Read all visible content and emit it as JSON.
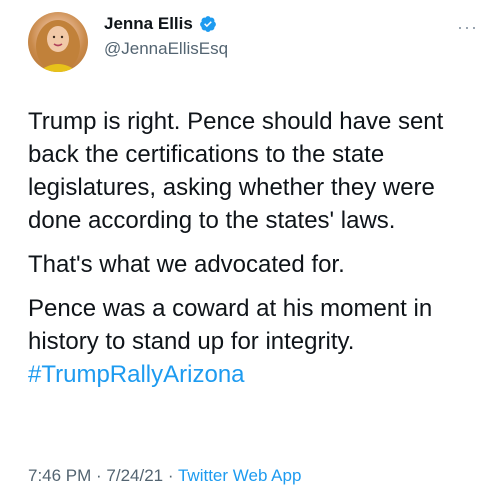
{
  "author": {
    "display_name": "Jenna Ellis",
    "handle": "@JennaEllisEsq",
    "verified": true
  },
  "menu_icon": "more-horizontal-icon",
  "tweet": {
    "paragraphs": [
      "Trump is right. Pence should have sent back the certifications to the state legislatures, asking whether they were done according to the states' laws.",
      "That's what we advocated for.",
      "Pence was a coward at his moment in history to stand up for integrity."
    ],
    "hashtag": "#TrumpRallyArizona"
  },
  "meta": {
    "time": "7:46 PM",
    "separator": " · ",
    "date": "7/24/21",
    "source": "Twitter Web App"
  },
  "colors": {
    "link": "#1d9bf0",
    "text": "#0f1419",
    "secondary": "#536471"
  }
}
